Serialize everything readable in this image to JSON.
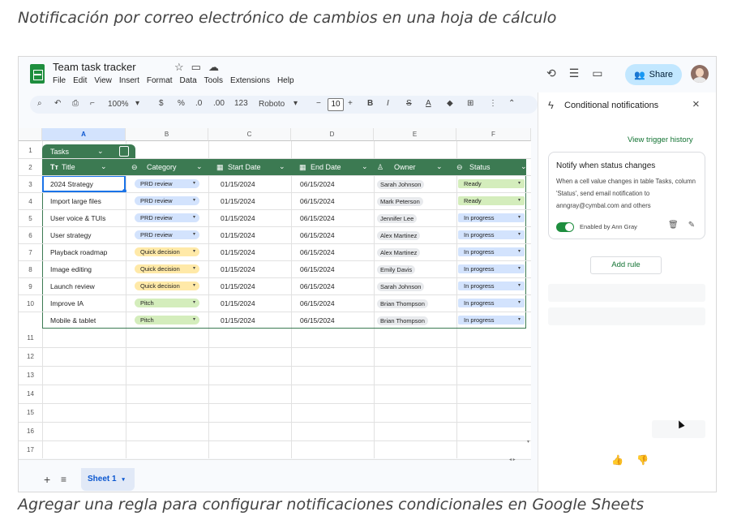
{
  "captions": {
    "top": "Notificación por correo electrónico de cambios en una hoja de cálculo",
    "bottom": "Agregar una regla para configurar notificaciones condicionales en Google Sheets"
  },
  "app": {
    "doc_title": "Team task tracker",
    "menu": [
      "File",
      "Edit",
      "View",
      "Insert",
      "Format",
      "Data",
      "Tools",
      "Extensions",
      "Help"
    ],
    "share_label": "Share"
  },
  "toolbar": {
    "zoom": "100%",
    "currency": "$",
    "percent": "%",
    "dec_less": ".0",
    "dec_more": ".00",
    "number_format": "123",
    "font": "Roboto",
    "font_size": "10"
  },
  "grid": {
    "columns": [
      "A",
      "B",
      "C",
      "D",
      "E",
      "F"
    ],
    "row_numbers": [
      "1",
      "2",
      "3",
      "4",
      "5",
      "6",
      "7",
      "8",
      "9",
      "10",
      "11",
      "12",
      "13",
      "14",
      "15",
      "16",
      "17"
    ],
    "selected_column": "A"
  },
  "table": {
    "name": "Tasks",
    "headers": [
      "Title",
      "Category",
      "Start Date",
      "End Date",
      "Owner",
      "Status"
    ],
    "rows": [
      {
        "title": "2024 Strategy",
        "category": "PRD review",
        "start": "01/15/2024",
        "end": "06/15/2024",
        "owner": "Sarah Johnson",
        "status": "Ready"
      },
      {
        "title": "Import large files",
        "category": "PRD review",
        "start": "01/15/2024",
        "end": "06/15/2024",
        "owner": "Mark Peterson",
        "status": "Ready"
      },
      {
        "title": "User voice & TUIs",
        "category": "PRD review",
        "start": "01/15/2024",
        "end": "06/15/2024",
        "owner": "Jennifer Lee",
        "status": "In progress"
      },
      {
        "title": "User strategy",
        "category": "PRD review",
        "start": "01/15/2024",
        "end": "06/15/2024",
        "owner": "Alex Martinez",
        "status": "In progress"
      },
      {
        "title": "Playback roadmap",
        "category": "Quick decision",
        "start": "01/15/2024",
        "end": "06/15/2024",
        "owner": "Alex Martinez",
        "status": "In progress"
      },
      {
        "title": "Image editing",
        "category": "Quick decision",
        "start": "01/15/2024",
        "end": "06/15/2024",
        "owner": "Emily Davis",
        "status": "In progress"
      },
      {
        "title": "Launch review",
        "category": "Quick decision",
        "start": "01/15/2024",
        "end": "06/15/2024",
        "owner": "Sarah Johnson",
        "status": "In progress"
      },
      {
        "title": "Improve IA",
        "category": "Pitch",
        "start": "01/15/2024",
        "end": "06/15/2024",
        "owner": "Brian Thompson",
        "status": "In progress"
      },
      {
        "title": "Mobile & tablet",
        "category": "Pitch",
        "start": "01/15/2024",
        "end": "06/15/2024",
        "owner": "Brian Thompson",
        "status": "In progress"
      }
    ]
  },
  "chip_colors": {
    "PRD review": "#d3e3fd",
    "Quick decision": "#ffe9a8",
    "Pitch": "#d4edbc",
    "Ready": "#d4edbc",
    "In progress": "#d3e3fd"
  },
  "sheet_tab": "Sheet 1",
  "panel": {
    "title": "Conditional notifications",
    "trigger_link": "View trigger history",
    "rule": {
      "title": "Notify when status changes",
      "description": "When a cell value changes in table Tasks, column 'Status', send email notification to anngray@cymbal.com and others",
      "enabled_by": "Enabled by Ann Gray",
      "enabled": true
    },
    "add_rule": "Add rule"
  },
  "icons": [
    "sheets-logo-icon",
    "star-icon",
    "folder-icon",
    "cloud-icon",
    "history-icon",
    "comment-icon",
    "video-icon",
    "people-icon",
    "search-icon",
    "undo-icon",
    "print-icon",
    "paint-format-icon",
    "bold-icon",
    "italic-icon",
    "strikethrough-icon",
    "text-color-icon",
    "fill-color-icon",
    "borders-icon",
    "more-icon",
    "collapse-icon",
    "bolt-icon",
    "close-icon",
    "trash-icon",
    "edit-icon",
    "thumbs-up-icon",
    "thumbs-down-icon",
    "add-sheet-icon",
    "sheet-list-icon"
  ]
}
